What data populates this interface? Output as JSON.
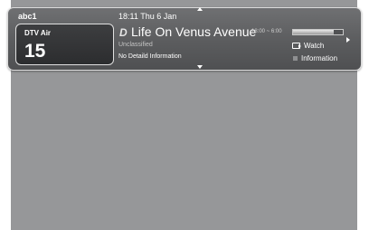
{
  "channel": {
    "name": "abc1",
    "type": "DTV Air",
    "number": "15"
  },
  "datetime": "18:11 Thu 6 Jan",
  "program": {
    "logo_glyph": "D",
    "title": "Life On Venus Avenue",
    "time_range": "18:00 ~ 6:00",
    "classification": "Unclassified",
    "detail": "No Detaild Information",
    "progress": 0.82
  },
  "actions": {
    "watch_label": "Watch",
    "information_label": "Information"
  },
  "icons": {
    "up": "arrow-up-icon",
    "down": "arrow-down-icon",
    "right": "arrow-right-icon",
    "watch": "watch-enter-icon",
    "info": "info-square-icon"
  },
  "colors": {
    "background": "#969799",
    "banner": "#5e5f61",
    "progress_fill": "#d0d0d0"
  }
}
